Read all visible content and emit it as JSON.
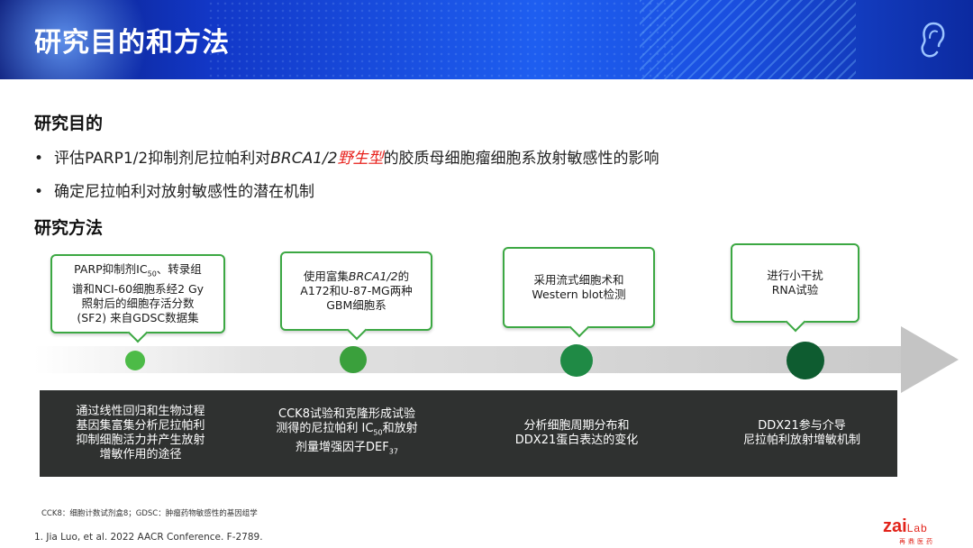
{
  "header": {
    "title": "研究目的和方法"
  },
  "purpose": {
    "title": "研究目的",
    "bullets": [
      {
        "prefix": "评估PARP1/2抑制剂尼拉帕利对",
        "italic": "BRCA1/2",
        "red": "野生型",
        "suffix": "的胶质母细胞瘤细胞系放射敏感性的影响"
      },
      {
        "text": "确定尼拉帕利对放射敏感性的潜在机制"
      }
    ],
    "bullet_symbol": "•"
  },
  "methods": {
    "title": "研究方法",
    "steps": [
      {
        "callout": [
          "PARP抑制剂IC",
          "50",
          "、转录组",
          "谱和NCI-60细胞系经2 Gy",
          "照射后的细胞存活分数",
          "(SF2) 来自GDSC数据集"
        ],
        "result": [
          "通过线性回归和生物过程",
          "基因集富集分析尼拉帕利",
          "抑制细胞活力并产生放射",
          "增敏作用的途径"
        ],
        "color": "#4cbb47"
      },
      {
        "callout": [
          "使用富集",
          "BRCA1/2",
          "的",
          "A172和U-87-MG两种",
          "GBM细胞系"
        ],
        "result": [
          "CCK8试验和克隆形成试验",
          "测得的尼拉帕利 IC",
          "50",
          "和放射",
          "剂量增强因子DEF",
          "37"
        ],
        "color": "#3aa03c"
      },
      {
        "callout": [
          "采用流式细胞术和",
          "Western blot检测"
        ],
        "result": [
          "分析细胞周期分布和",
          "DDX21蛋白表达的变化"
        ],
        "color": "#1f8a45"
      },
      {
        "callout": [
          "进行小干扰",
          "RNA试验"
        ],
        "result": [
          "DDX21参与介导",
          "尼拉帕利放射增敏机制"
        ],
        "color": "#0e5c30"
      }
    ]
  },
  "footnote": "CCK8：细胞计数试剂盒8；GDSC：肿瘤药物敏感性的基因组学",
  "reference": "1.   Jia Luo, et al. 2022 AACR Conference. F-2789.",
  "logo": {
    "brand": "zai",
    "lab": "Lab",
    "sub": "再鼎医药",
    "color": "#e2231a"
  },
  "icons": {
    "header_right": "ear-icon"
  }
}
